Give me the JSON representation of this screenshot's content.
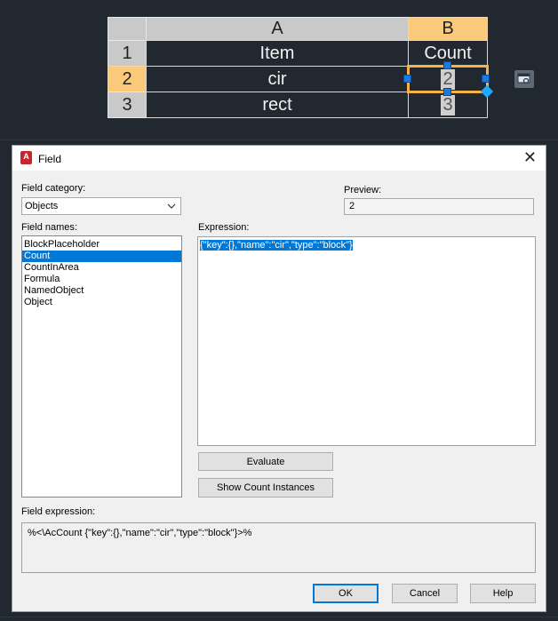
{
  "table": {
    "col_headers": [
      "A",
      "B"
    ],
    "row_headers": [
      "1",
      "2",
      "3"
    ],
    "rows": [
      [
        "Item",
        "Count"
      ],
      [
        "cir",
        "2"
      ],
      [
        "rect",
        "3"
      ]
    ]
  },
  "colors": {
    "canvas_bg": "#212830",
    "selection": "#f5b347",
    "grip": "#1d7be0",
    "list_selection": "#0078d7"
  },
  "dialog": {
    "title": "Field",
    "close_icon": "close-icon",
    "field_category_label": "Field category:",
    "field_category_value": "Objects",
    "preview_label": "Preview:",
    "preview_value": "2",
    "field_names_label": "Field names:",
    "field_names": [
      "BlockPlaceholder",
      "Count",
      "CountInArea",
      "Formula",
      "NamedObject",
      "Object"
    ],
    "field_names_selected": "Count",
    "expression_label": "Expression:",
    "expression_value": "{\"key\":{},\"name\":\"cir\",\"type\":\"block\"}",
    "evaluate_button": "Evaluate",
    "show_count_button": "Show Count Instances",
    "field_expression_label": "Field expression:",
    "field_expression_value": "%<\\AcCount {\"key\":{},\"name\":\"cir\",\"type\":\"block\"}>%",
    "ok_button": "OK",
    "cancel_button": "Cancel",
    "help_button": "Help"
  }
}
